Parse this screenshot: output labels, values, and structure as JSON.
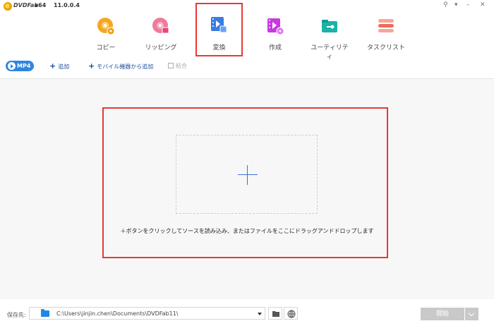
{
  "titlebar": {
    "brand": "DVDFab",
    "edition": "x64",
    "version": "11.0.0.4",
    "controls": [
      "⚲",
      "▾",
      "–",
      "✕"
    ]
  },
  "nav": {
    "items": [
      {
        "label": "コピー",
        "icon": "disc-copy-icon",
        "color": "#f5a623"
      },
      {
        "label": "リッピング",
        "icon": "disc-rip-icon",
        "color": "#e8457a"
      },
      {
        "label": "変換",
        "icon": "video-convert-icon",
        "color": "#3a7be0",
        "active": true
      },
      {
        "label": "作成",
        "icon": "video-create-icon",
        "color": "#c63adf"
      },
      {
        "label": "ユーティリティ",
        "icon": "toolbox-icon",
        "color": "#19b3a8"
      },
      {
        "label": "タスクリスト",
        "icon": "task-list-icon",
        "color": "#ef6b5b"
      }
    ]
  },
  "toolbar": {
    "profile": "MP4",
    "add": "追加",
    "add_mobile": "モバイル機器から追加",
    "merge": "結合"
  },
  "main": {
    "hint": "＋ボタンをクリックしてソースを読み込み、またはファイルをここにドラッグアンドドロップします"
  },
  "bottom": {
    "save_label": "保存先:",
    "path": "C:\\Users\\jinjin.chen\\Documents\\DVDFab11\\",
    "start": "開始"
  },
  "colors": {
    "accent": "#2e86de",
    "highlight": "#e53935"
  }
}
